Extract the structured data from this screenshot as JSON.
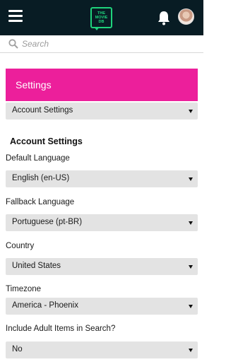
{
  "header": {
    "menu_icon": "hamburger-menu-icon",
    "logo_text": "THE MOVIE DB",
    "notifications_icon": "bell-icon",
    "avatar_icon": "user-avatar"
  },
  "search": {
    "placeholder": "Search",
    "icon": "search-icon"
  },
  "settings": {
    "title": "Settings",
    "section_select": "Account Settings"
  },
  "account_settings": {
    "heading": "Account Settings",
    "default_language": {
      "label": "Default Language",
      "value": "English (en-US)"
    },
    "fallback_language": {
      "label": "Fallback Language",
      "value": "Portuguese (pt-BR)"
    },
    "country": {
      "label": "Country",
      "value": "United States"
    },
    "timezone": {
      "label": "Timezone",
      "value": "America - Phoenix"
    },
    "adult_items": {
      "label": "Include Adult Items in Search?",
      "value": "No"
    }
  },
  "colors": {
    "topbar": "#081c24",
    "accent": "#ec1f9b",
    "logo": "#1fd37c",
    "select_bg": "#e3e3e3"
  }
}
